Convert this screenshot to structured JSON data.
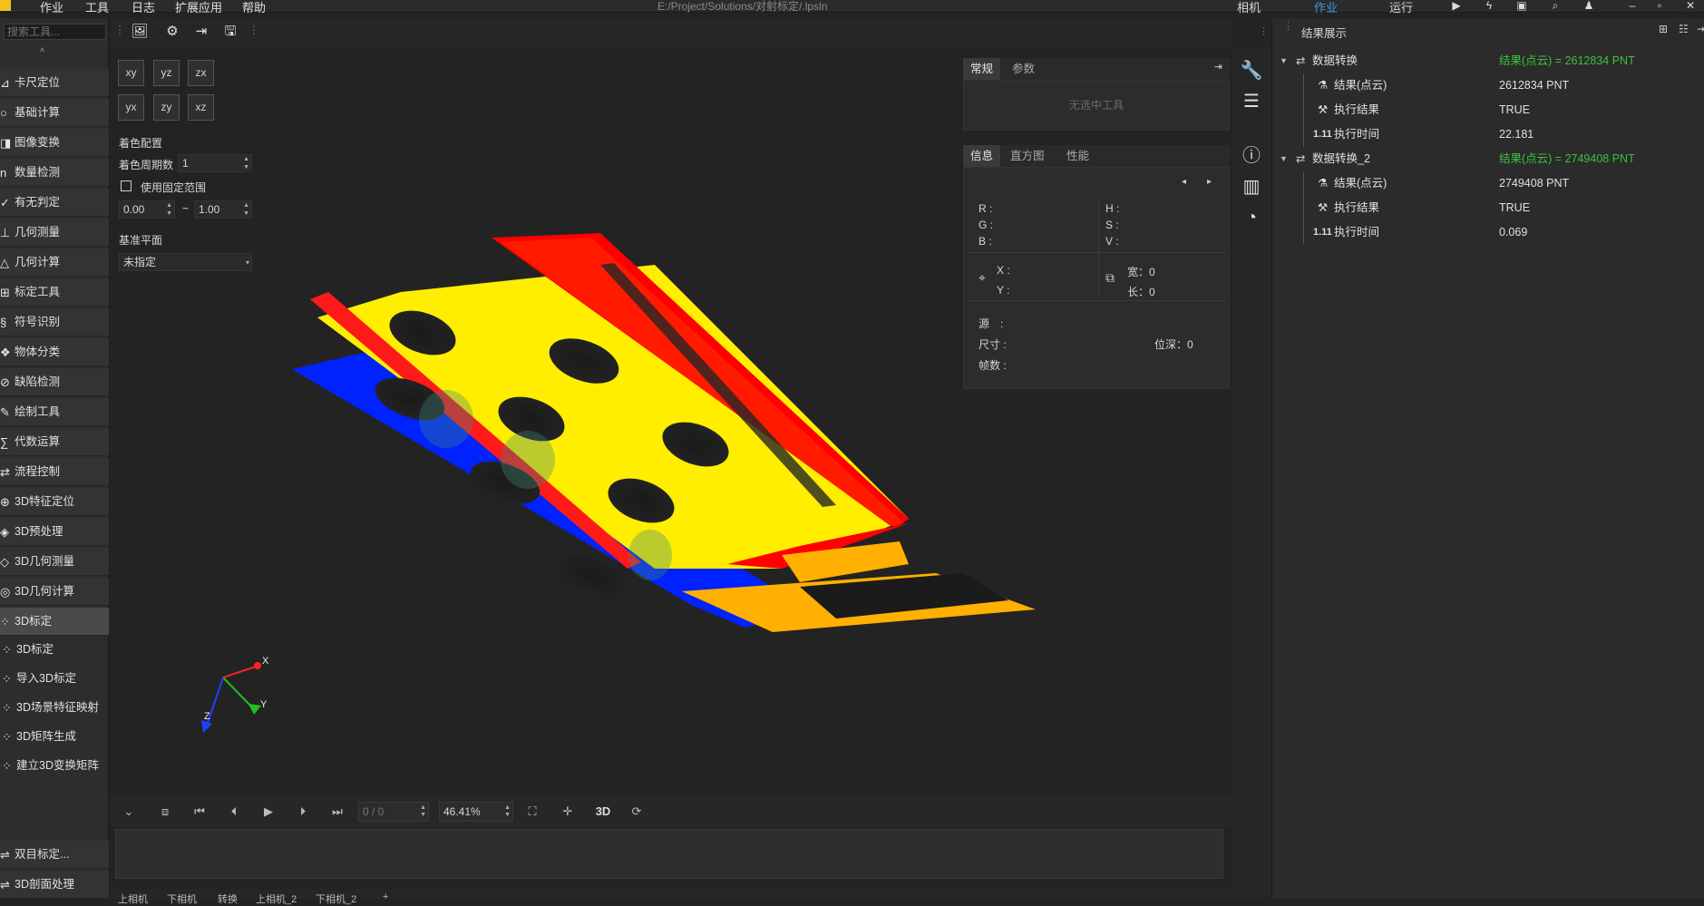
{
  "menubar": {
    "items": [
      "作业",
      "工具",
      "日志",
      "扩展应用",
      "帮助"
    ],
    "window_title": "E:/Project/Solutions/对射标定/.lpsln",
    "top_tabs": [
      {
        "label": "相机",
        "active": false
      },
      {
        "label": "作业",
        "active": true
      },
      {
        "label": "运行",
        "active": false
      }
    ],
    "accent": "#3a9be0"
  },
  "toolbox": {
    "search_placeholder": "搜索工具...",
    "categories": [
      {
        "label": "卡尺定位",
        "icon": "caliper-icon"
      },
      {
        "label": "基础计算",
        "icon": "circle-icon"
      },
      {
        "label": "图像变换",
        "icon": "image-transform-icon"
      },
      {
        "label": "数量检测",
        "icon": "count-icon"
      },
      {
        "label": "有无判定",
        "icon": "check-icon"
      },
      {
        "label": "几何测量",
        "icon": "ruler-icon"
      },
      {
        "label": "几何计算",
        "icon": "geometry-icon"
      },
      {
        "label": "标定工具",
        "icon": "calibrate-icon"
      },
      {
        "label": "符号识别",
        "icon": "symbol-icon"
      },
      {
        "label": "物体分类",
        "icon": "classify-icon"
      },
      {
        "label": "缺陷检测",
        "icon": "defect-icon"
      },
      {
        "label": "绘制工具",
        "icon": "draw-icon"
      },
      {
        "label": "代数运算",
        "icon": "algebra-icon"
      },
      {
        "label": "流程控制",
        "icon": "flow-icon"
      },
      {
        "label": "3D特征定位",
        "icon": "3d-feature-icon"
      },
      {
        "label": "3D预处理",
        "icon": "3d-preprocess-icon"
      },
      {
        "label": "3D几何测量",
        "icon": "3d-measure-icon"
      },
      {
        "label": "3D几何计算",
        "icon": "3d-compute-icon"
      },
      {
        "label": "3D标定",
        "icon": "3d-calibrate-icon"
      }
    ],
    "selected_category": "3D标定",
    "sub_items": [
      {
        "label": "3D标定",
        "icon": "3d-calibrate-icon"
      },
      {
        "label": "导入3D标定",
        "icon": "import-icon"
      },
      {
        "label": "3D场景特征映射",
        "icon": "map-icon"
      },
      {
        "label": "3D矩阵生成",
        "icon": "matrix-icon"
      },
      {
        "label": "建立3D变换矩阵",
        "icon": "transform-matrix-icon"
      }
    ],
    "bottom_items": [
      {
        "label": "双目标定...",
        "icon": "stereo-icon"
      },
      {
        "label": "3D剖面处理",
        "icon": "profile-icon"
      }
    ]
  },
  "view_controls": {
    "axis_buttons": [
      "xy",
      "yz",
      "zx",
      "yx",
      "zy",
      "xz"
    ],
    "color_config_label": "着色配置",
    "color_period_label": "着色周期数",
    "color_period_value": "1",
    "fixed_range_label": "使用固定范围",
    "range_min": "0.00",
    "range_sep": "~",
    "range_max": "1.00",
    "base_plane_label": "基准平面",
    "base_plane_value": "未指定"
  },
  "axis_labels": {
    "x": "X",
    "y": "Y",
    "z": "Z"
  },
  "tool_panel": {
    "tabs": [
      "常规",
      "参数"
    ],
    "empty_text": "无选中工具"
  },
  "info_panel": {
    "tabs": [
      "信息",
      "直方图",
      "性能"
    ],
    "r": "R :",
    "g": "G :",
    "b": "B :",
    "h": "H :",
    "s": "S :",
    "v": "V :",
    "x": "X :",
    "y": "Y :",
    "width": "宽：0",
    "length": "长：0",
    "source": "源　:",
    "size": "尺寸 :",
    "depth": "位深：0",
    "fps": "帧数 :"
  },
  "results": {
    "title": "结果展示",
    "groups": [
      {
        "name": "数据转换",
        "summary": "结果(点云) = 2612834 PNT",
        "rows": [
          {
            "icon": "flask-icon",
            "label": "结果(点云)",
            "value": "2612834 PNT"
          },
          {
            "icon": "exec-icon",
            "label": "执行结果",
            "value": "TRUE"
          },
          {
            "icon": "number-icon",
            "icon_text": "1.11",
            "label": "执行时间",
            "value": "22.181"
          }
        ]
      },
      {
        "name": "数据转换_2",
        "summary": "结果(点云) = 2749408 PNT",
        "rows": [
          {
            "icon": "flask-icon",
            "label": "结果(点云)",
            "value": "2749408 PNT"
          },
          {
            "icon": "exec-icon",
            "label": "执行结果",
            "value": "TRUE"
          },
          {
            "icon": "number-icon",
            "icon_text": "1.11",
            "label": "执行时间",
            "value": "0.069"
          }
        ]
      }
    ],
    "summary_color": "#3cc13c"
  },
  "playbar": {
    "frame": "0 / 0",
    "zoom": "46.41%",
    "mode_3d": "3D"
  },
  "bottom_tabs": [
    "上相机",
    "下相机",
    "转换",
    "上相机_2",
    "下相机_2",
    "+"
  ],
  "point_cloud_colors": {
    "red": "#ff0000",
    "yellow": "#ffee00",
    "blue": "#0022ff",
    "orange": "#ffb000"
  }
}
